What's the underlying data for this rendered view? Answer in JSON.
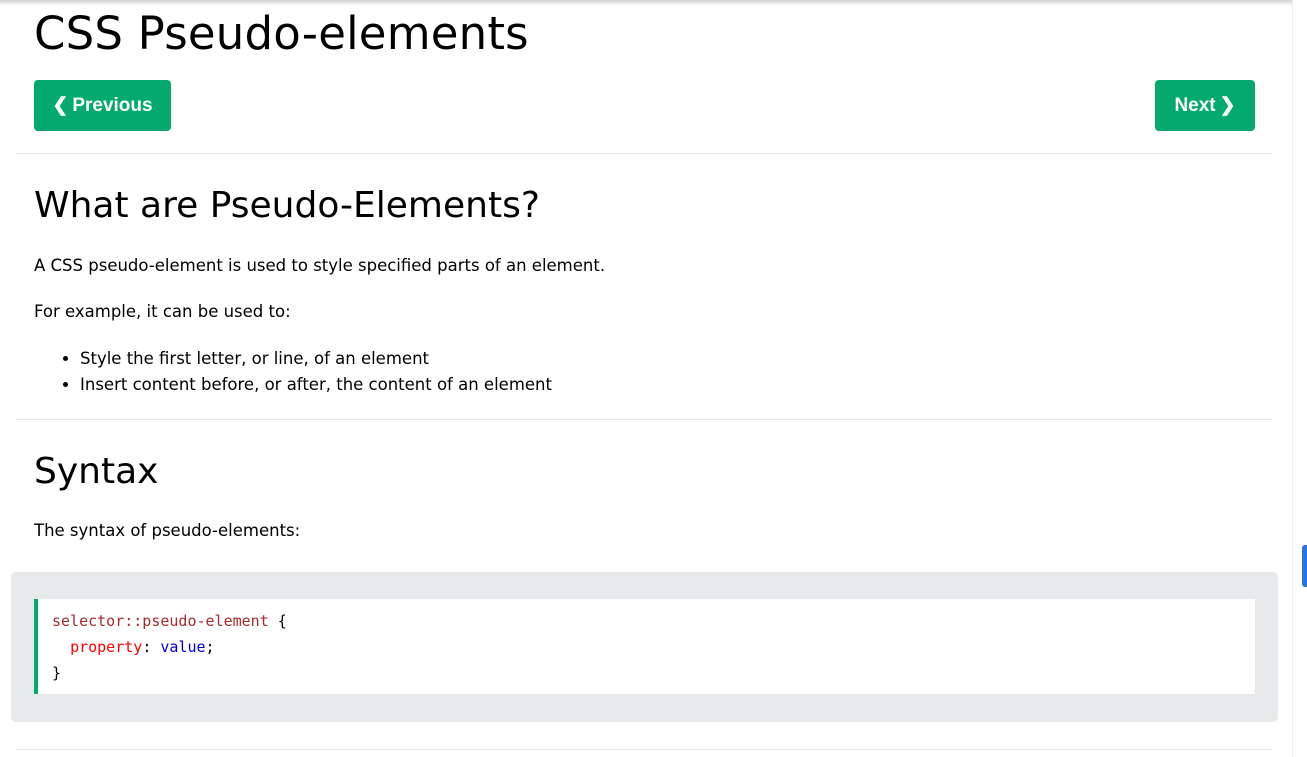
{
  "page": {
    "title": "CSS Pseudo-elements"
  },
  "nav": {
    "previous_label": "Previous",
    "next_label": "Next",
    "previous_icon": "chevron-left-icon",
    "next_icon": "chevron-right-icon",
    "button_color": "#04aa6d"
  },
  "section_what": {
    "heading": "What are Pseudo-Elements?",
    "intro": "A CSS pseudo-element is used to style specified parts of an element.",
    "example_lead": "For example, it can be used to:",
    "bullets": [
      "Style the first letter, or line, of an element",
      "Insert content before, or after, the content of an element"
    ]
  },
  "section_syntax": {
    "heading": "Syntax",
    "intro": "The syntax of pseudo-elements:",
    "code": {
      "selector": "selector::pseudo-element",
      "open_brace": " {",
      "property": "property",
      "colon": ": ",
      "value": "value",
      "semicolon": ";",
      "close_brace": "}"
    }
  },
  "colors": {
    "accent": "#04aa6d",
    "code_bg": "#e7e9eb",
    "selector": "#a52a2a",
    "property": "#ff0000",
    "value": "#0000cd"
  }
}
